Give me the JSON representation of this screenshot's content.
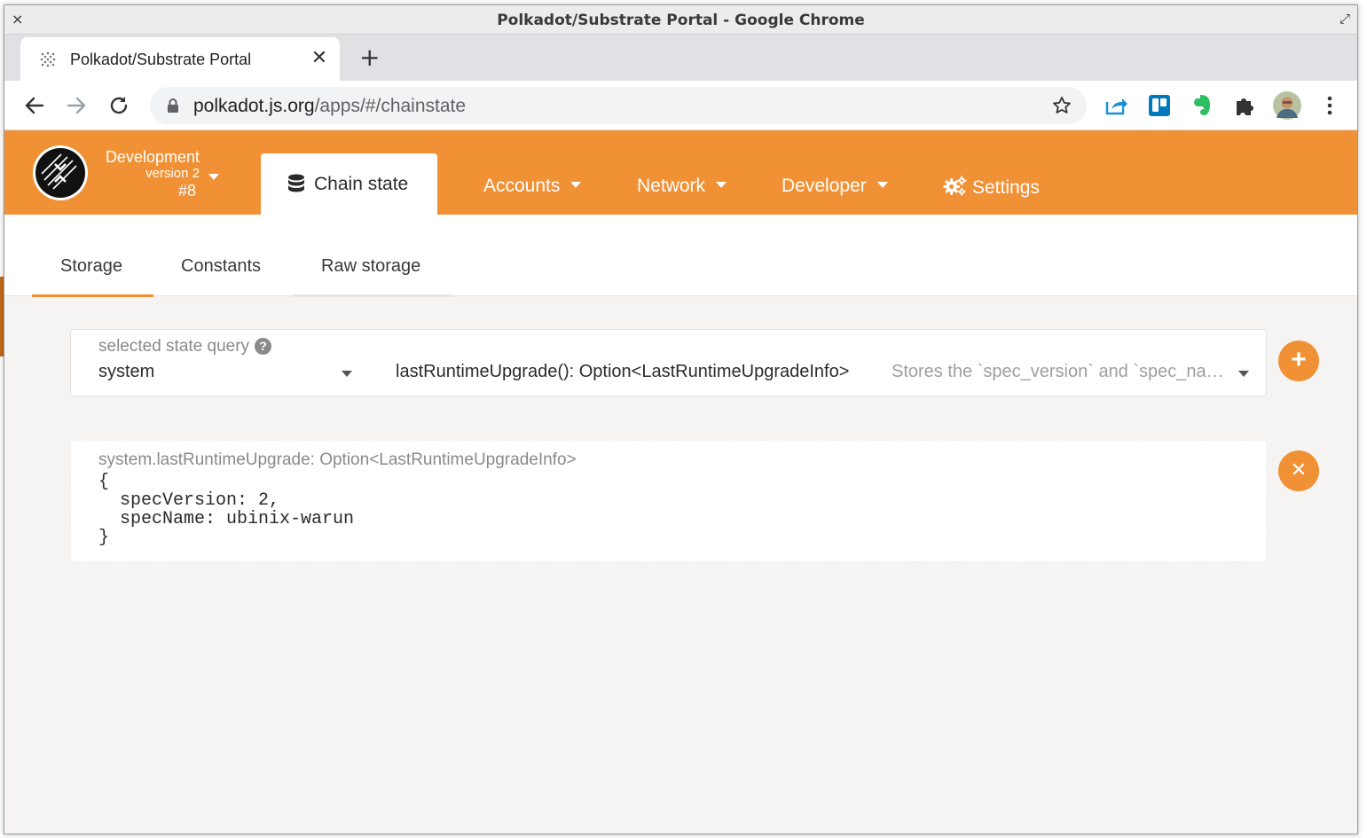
{
  "window": {
    "title": "Polkadot/Substrate Portal - Google Chrome",
    "close_glyph": "×",
    "maximize_glyph": "⤢"
  },
  "browser": {
    "tab_title": "Polkadot/Substrate Portal",
    "tab_close_glyph": "✕",
    "new_tab_glyph": "+",
    "url_host": "polkadot.js.org",
    "url_path": "/apps/#/chainstate"
  },
  "app": {
    "accent_color": "#f19135",
    "chain": {
      "network": "Development",
      "version": "version 2",
      "block": "#8"
    },
    "menu": {
      "active": "Chain state",
      "items": [
        {
          "label": "Accounts",
          "has_dropdown": true
        },
        {
          "label": "Network",
          "has_dropdown": true
        },
        {
          "label": "Developer",
          "has_dropdown": true
        },
        {
          "label": "Settings",
          "has_dropdown": false,
          "icon": "gears-icon"
        }
      ]
    },
    "subtabs": [
      {
        "label": "Storage",
        "active": true
      },
      {
        "label": "Constants",
        "active": false
      },
      {
        "label": "Raw storage",
        "active": false
      }
    ],
    "query": {
      "label": "selected state query",
      "help_glyph": "?",
      "section": "system",
      "method": "lastRuntimeUpgrade(): Option<LastRuntimeUpgradeInfo>",
      "description": "Stores the `spec_version` and `spec_name` of when the last runtime upgrade happened.",
      "add_glyph": "+"
    },
    "result": {
      "label": "system.lastRuntimeUpgrade: Option<LastRuntimeUpgradeInfo>",
      "value": "{\n  specVersion: 2,\n  specName: ubinix-warun\n}",
      "remove_glyph": "✕"
    }
  }
}
